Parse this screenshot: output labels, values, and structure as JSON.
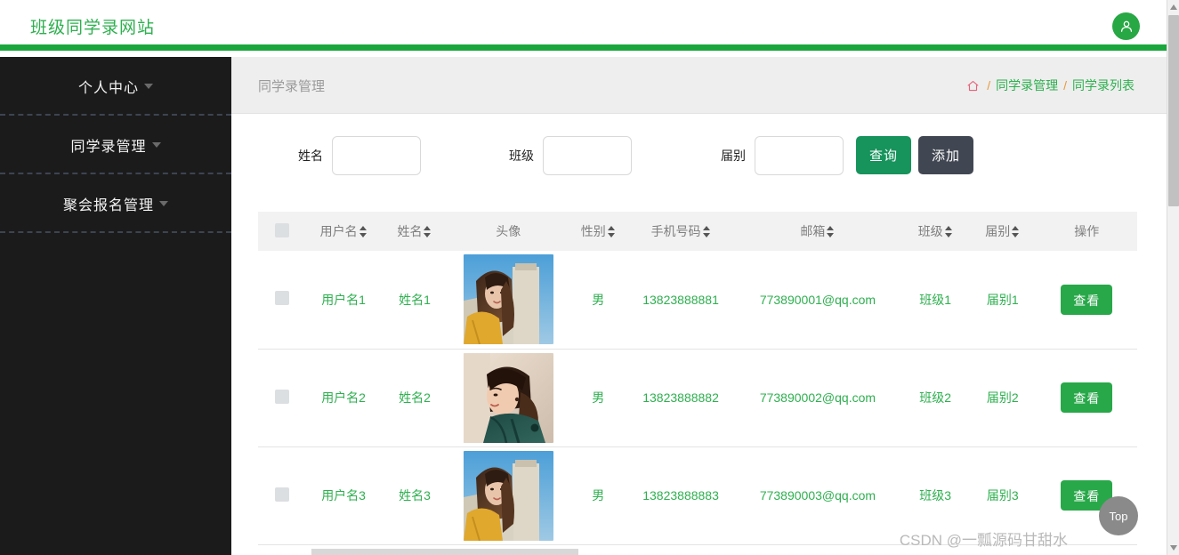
{
  "header": {
    "brand": "班级同学录网站",
    "avatar_icon": "user-icon"
  },
  "sidebar": {
    "items": [
      {
        "label": "个人中心",
        "icon": "chevron-down-icon"
      },
      {
        "label": "同学录管理",
        "icon": "chevron-down-icon"
      },
      {
        "label": "聚会报名管理",
        "icon": "chevron-down-icon"
      }
    ]
  },
  "page": {
    "title": "同学录管理",
    "breadcrumb": {
      "home_icon": "home-icon",
      "separator": "/",
      "items": [
        "同学录管理",
        "同学录列表"
      ]
    }
  },
  "search": {
    "fields": [
      {
        "label": "姓名",
        "value": "",
        "placeholder": ""
      },
      {
        "label": "班级",
        "value": "",
        "placeholder": ""
      },
      {
        "label": "届别",
        "value": "",
        "placeholder": ""
      }
    ],
    "query_label": "查询",
    "add_label": "添加",
    "query_color": "#17935c",
    "add_color": "#414752"
  },
  "table": {
    "columns": [
      {
        "label": "",
        "sortable": false,
        "key": "checkbox"
      },
      {
        "label": "用户名",
        "sortable": true,
        "key": "username"
      },
      {
        "label": "姓名",
        "sortable": true,
        "key": "name"
      },
      {
        "label": "头像",
        "sortable": false,
        "key": "avatar"
      },
      {
        "label": "性别",
        "sortable": true,
        "key": "sex"
      },
      {
        "label": "手机号码",
        "sortable": true,
        "key": "phone"
      },
      {
        "label": "邮箱",
        "sortable": true,
        "key": "email"
      },
      {
        "label": "班级",
        "sortable": true,
        "key": "class"
      },
      {
        "label": "届别",
        "sortable": true,
        "key": "batch"
      },
      {
        "label": "操作",
        "sortable": false,
        "key": "ops"
      }
    ],
    "action_label": "查看",
    "rows": [
      {
        "username": "用户名1",
        "name": "姓名1",
        "avatar": "portrait-girl-yellow-jacket",
        "sex": "男",
        "phone": "13823888881",
        "email": "773890001@qq.com",
        "class": "班级1",
        "batch": "届别1",
        "action": "查看"
      },
      {
        "username": "用户名2",
        "name": "姓名2",
        "avatar": "portrait-girl-green-coat",
        "sex": "男",
        "phone": "13823888882",
        "email": "773890002@qq.com",
        "class": "班级2",
        "batch": "届别2",
        "action": "查看"
      },
      {
        "username": "用户名3",
        "name": "姓名3",
        "avatar": "portrait-girl-yellow-jacket",
        "sex": "男",
        "phone": "13823888883",
        "email": "773890003@qq.com",
        "class": "班级3",
        "batch": "届别3",
        "action": "查看"
      }
    ]
  },
  "floating": {
    "top_button": "Top"
  },
  "watermark": "CSDN @一瓢源码甘甜水",
  "colors": {
    "brand_green": "#2eb04f",
    "bar_green": "#1aa63c",
    "sidebar_dark": "#1b1b1b",
    "breadcrumb_sep": "#e89a3c",
    "action_green": "#28a849"
  }
}
